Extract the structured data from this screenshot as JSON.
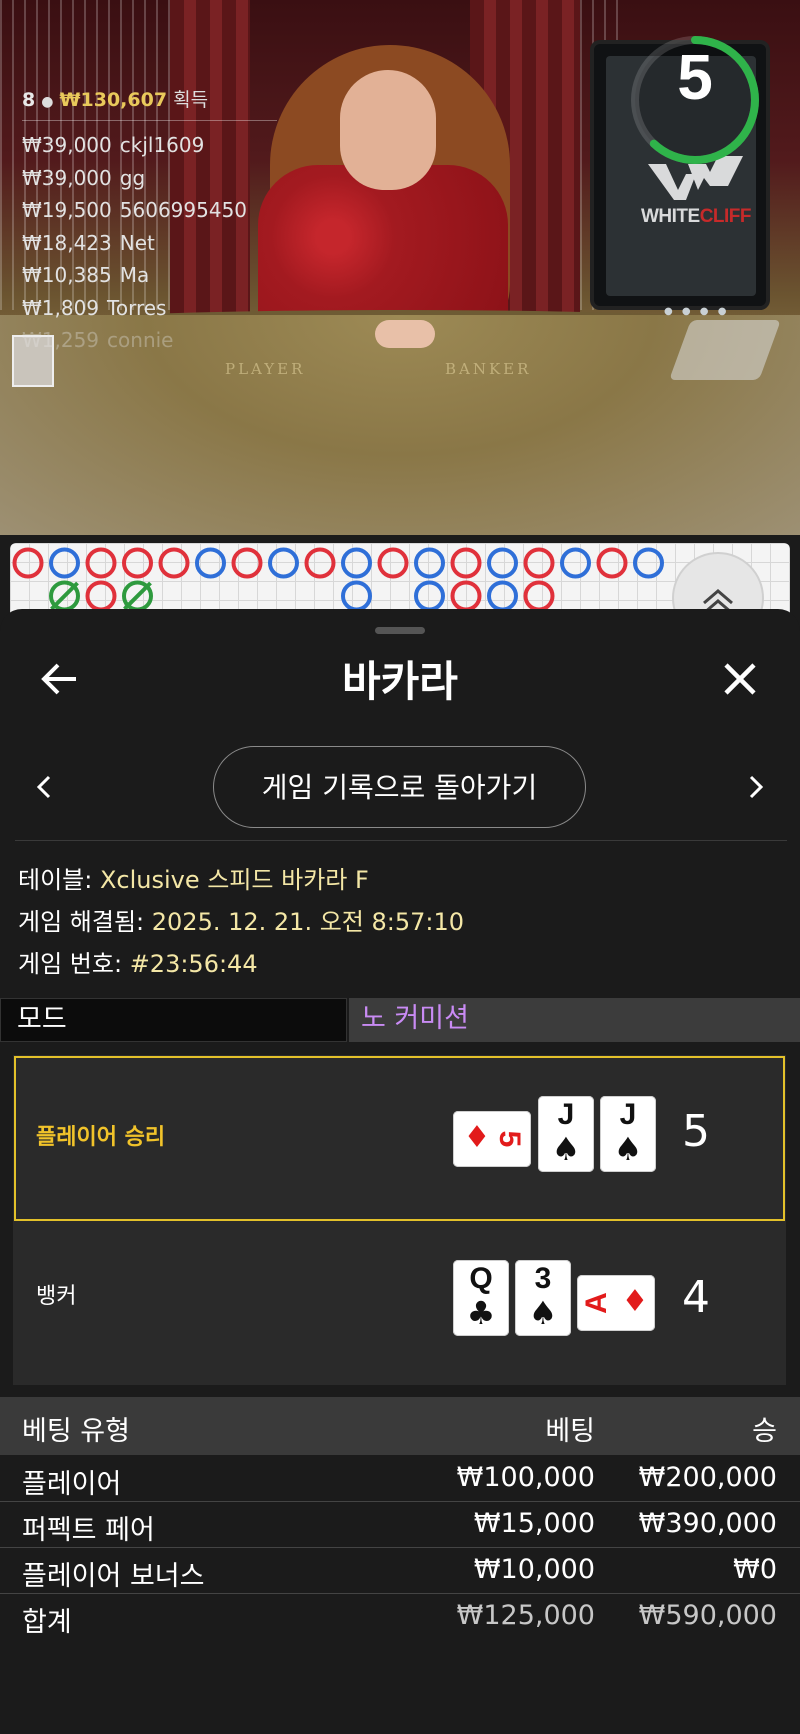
{
  "video": {
    "winners": {
      "count": "8",
      "total": "₩130,607",
      "suffix": "획득",
      "list": [
        {
          "amount": "₩39,000",
          "name": "ckjl1609"
        },
        {
          "amount": "₩39,000",
          "name": "gg"
        },
        {
          "amount": "₩19,500",
          "name": "5606995450"
        },
        {
          "amount": "₩18,423",
          "name": "Net"
        },
        {
          "amount": "₩10,385",
          "name": "Ma"
        },
        {
          "amount": "₩1,809",
          "name": "Torres"
        },
        {
          "amount": "₩1,259",
          "name": "connie"
        }
      ]
    },
    "timer": "5",
    "timer_fraction": 0.62,
    "felt_player": "PLAYER",
    "felt_banker": "BANKER",
    "logo_white": "WHITE",
    "logo_red": "CLIFF"
  },
  "roadmap": {
    "colors": {
      "player": "#2f6fd8",
      "banker": "#e0313b",
      "tie": "#2e9a3e"
    },
    "top_row": [
      "B",
      "P",
      "B",
      "B",
      "B",
      "P",
      "B",
      "P",
      "B",
      "P",
      "B",
      "P",
      "B",
      "P",
      "B",
      "P",
      "B",
      "P"
    ],
    "second_row": [
      null,
      "T",
      "B",
      "T",
      null,
      null,
      null,
      null,
      null,
      "P",
      null,
      "P",
      "B",
      "P",
      "B",
      null,
      null,
      null
    ],
    "expand_icon": "chevron-double-up-icon"
  },
  "sheet": {
    "title": "바카라",
    "back_icon": "arrow-left-icon",
    "close_icon": "close-icon",
    "back_to_history": "게임 기록으로 돌아가기",
    "table_label": "테이블:",
    "table_value": "Xclusive 스피드 바카라 F",
    "resolved_label": "게임 해결됨:",
    "resolved_value": "2025. 12. 21. 오전 8:57:10",
    "game_no_label": "게임 번호:",
    "game_no_value": "#23:56:44",
    "mode_label": "모드",
    "mode_value": "노 커미션",
    "accent": "#e3c12a"
  },
  "outcome": {
    "player": {
      "label": "플레이어 승리",
      "score": "5",
      "cards": [
        {
          "rank": "5",
          "suit": "♦",
          "color": "red",
          "orientation": "sideways"
        },
        {
          "rank": "J",
          "suit": "♠",
          "color": "black",
          "orientation": "upright"
        },
        {
          "rank": "J",
          "suit": "♠",
          "color": "black",
          "orientation": "upright"
        }
      ]
    },
    "banker": {
      "label": "뱅커",
      "score": "4",
      "cards": [
        {
          "rank": "Q",
          "suit": "♣",
          "color": "black",
          "orientation": "upright"
        },
        {
          "rank": "3",
          "suit": "♠",
          "color": "black",
          "orientation": "upright"
        },
        {
          "rank": "A",
          "suit": "♦",
          "color": "red",
          "orientation": "sideways"
        }
      ]
    }
  },
  "bets": {
    "headers": {
      "type": "베팅 유형",
      "bet": "베팅",
      "win": "승"
    },
    "rows": [
      {
        "type": "플레이어",
        "bet": "₩100,000",
        "win": "₩200,000"
      },
      {
        "type": "퍼펙트 페어",
        "bet": "₩15,000",
        "win": "₩390,000"
      },
      {
        "type": "플레이어 보너스",
        "bet": "₩10,000",
        "win": "₩0"
      }
    ],
    "total": {
      "type": "합계",
      "bet": "₩125,000",
      "win": "₩590,000"
    }
  }
}
